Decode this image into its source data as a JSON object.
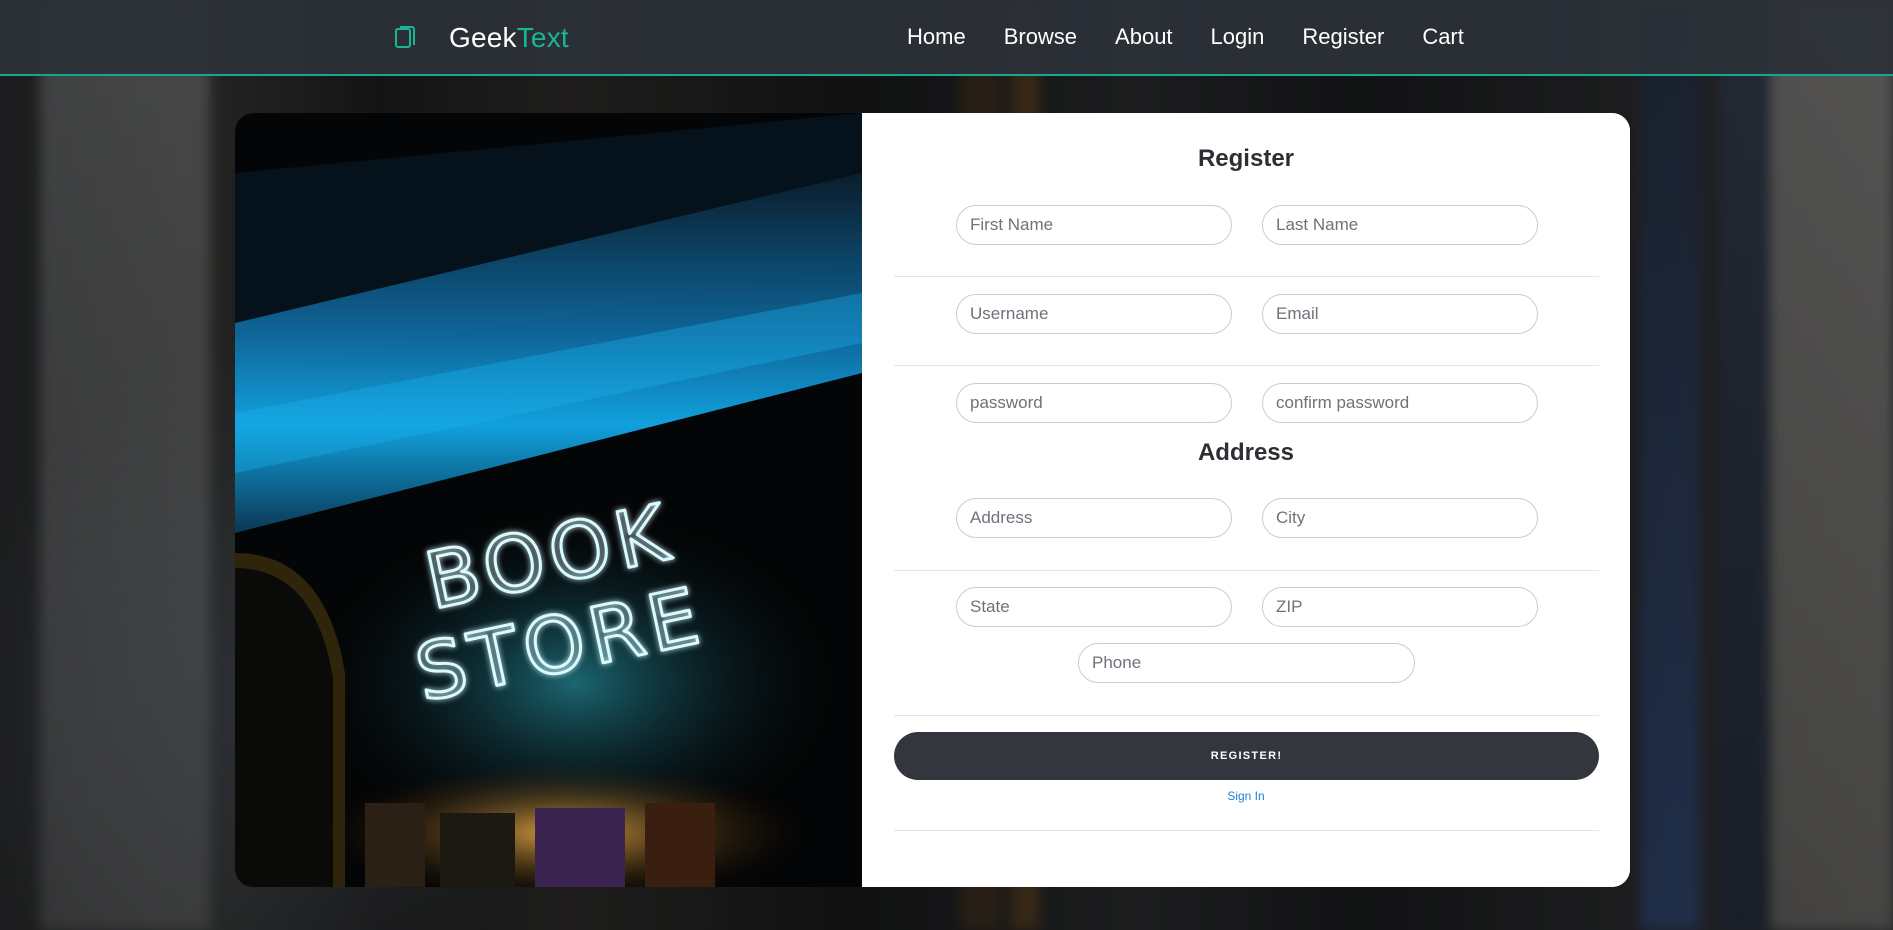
{
  "brand": {
    "name_part1": "Geek",
    "name_part2": "Text",
    "icon": "book-icon",
    "accent_color": "#19b595"
  },
  "nav": {
    "items": [
      {
        "label": "Home"
      },
      {
        "label": "Browse"
      },
      {
        "label": "About"
      },
      {
        "label": "Login"
      },
      {
        "label": "Register"
      },
      {
        "label": "Cart"
      }
    ]
  },
  "hero_image": {
    "neon_line1": "BOOK",
    "neon_line2": "STORE"
  },
  "form": {
    "title": "Register",
    "fields": {
      "first_name": {
        "placeholder": "First Name",
        "value": ""
      },
      "last_name": {
        "placeholder": "Last Name",
        "value": ""
      },
      "username": {
        "placeholder": "Username",
        "value": ""
      },
      "email": {
        "placeholder": "Email",
        "value": ""
      },
      "password": {
        "placeholder": "password",
        "value": ""
      },
      "confirm_password": {
        "placeholder": "confirm password",
        "value": ""
      }
    },
    "address_title": "Address",
    "address_fields": {
      "address": {
        "placeholder": "Address",
        "value": ""
      },
      "city": {
        "placeholder": "City",
        "value": ""
      },
      "state": {
        "placeholder": "State",
        "value": ""
      },
      "zip": {
        "placeholder": "ZIP",
        "value": ""
      },
      "phone": {
        "placeholder": "Phone",
        "value": ""
      }
    },
    "submit_label": "REGISTER!",
    "signin_label": "Sign In",
    "button_color": "#33363c",
    "link_color": "#1f7fd6"
  }
}
